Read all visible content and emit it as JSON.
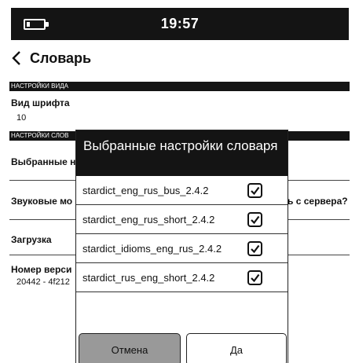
{
  "status": {
    "time": "19:57",
    "battery_icon": "battery-icon"
  },
  "header": {
    "title": "Словарь",
    "back_icon": "chevron-left-icon"
  },
  "sections": {
    "view": "НАСТРОЙКИ ВИДА",
    "dictionaries": "НАСТРОЙКИ СЛОВ"
  },
  "settings": {
    "font_size_label": "Вид шрифта",
    "font_size_value": "10",
    "selected_label": "Выбранные н",
    "sound_label": "Звуковые мо",
    "sound_right": "ь с сервера?",
    "download_label": "Загрузка",
    "version_label": "Номер верси",
    "version_value": "20442 - 4f212"
  },
  "dialog": {
    "title": "Выбранные настройки словаря",
    "items": [
      {
        "name": "stardict_eng_rus_bus_2.4.2",
        "checked": true
      },
      {
        "name": "stardict_eng_rus_short_2.4.2",
        "checked": true
      },
      {
        "name": "stardict_idioms_eng_rus_2.4.2",
        "checked": true
      },
      {
        "name": "stardict_rus_eng_short_2.4.2",
        "checked": true
      }
    ],
    "cancel_label": "Отмена",
    "ok_label": "Да"
  }
}
